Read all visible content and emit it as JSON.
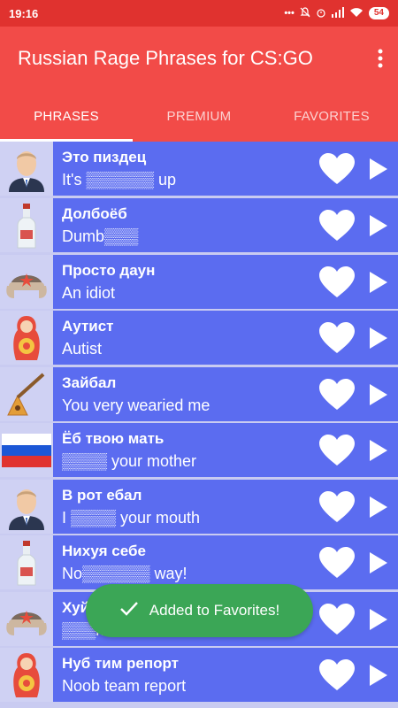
{
  "status_bar": {
    "time": "19:16",
    "battery": "54"
  },
  "app_bar": {
    "title": "Russian Rage Phrases for CS:GO",
    "menu_icon": "more-vert-icon"
  },
  "tabs": [
    {
      "label": "PHRASES",
      "active": true
    },
    {
      "label": "PREMIUM",
      "active": false
    },
    {
      "label": "FAVORITES",
      "active": false
    }
  ],
  "phrases": [
    {
      "ru": "Это пиздец",
      "en": "It's ▒▒▒▒▒▒ up",
      "image": "putin-avatar"
    },
    {
      "ru": "Долбоёб",
      "en": "Dumb▒▒▒",
      "image": "vodka-bottle"
    },
    {
      "ru": "Просто даун",
      "en": "An idiot",
      "image": "ushanka-hat"
    },
    {
      "ru": "Аутист",
      "en": "Autist",
      "image": "matryoshka-doll"
    },
    {
      "ru": "Зайбал",
      "en": "You very wearied me",
      "image": "balalaika"
    },
    {
      "ru": "Ёб твою мать",
      "en": "▒▒▒▒ your mother",
      "image": "russian-flag"
    },
    {
      "ru": "В рот ебал",
      "en": "I ▒▒▒▒ your mouth",
      "image": "putin-avatar"
    },
    {
      "ru": "Нихуя себе",
      "en": "No▒▒▒▒▒▒ way!",
      "image": "vodka-bottle"
    },
    {
      "ru": "Хуй знает",
      "en": "▒▒▒k knows",
      "image": "ushanka-hat"
    },
    {
      "ru": "Нуб тим репорт",
      "en": "Noob team report",
      "image": "matryoshka-doll"
    }
  ],
  "toast": {
    "message": "Added to Favorites!"
  },
  "colors": {
    "status_bar": "#e0322f",
    "app_bar": "#f24b48",
    "row": "#5b6cf0",
    "thumb_bg": "#cfd1f3",
    "toast": "#3ba656"
  }
}
